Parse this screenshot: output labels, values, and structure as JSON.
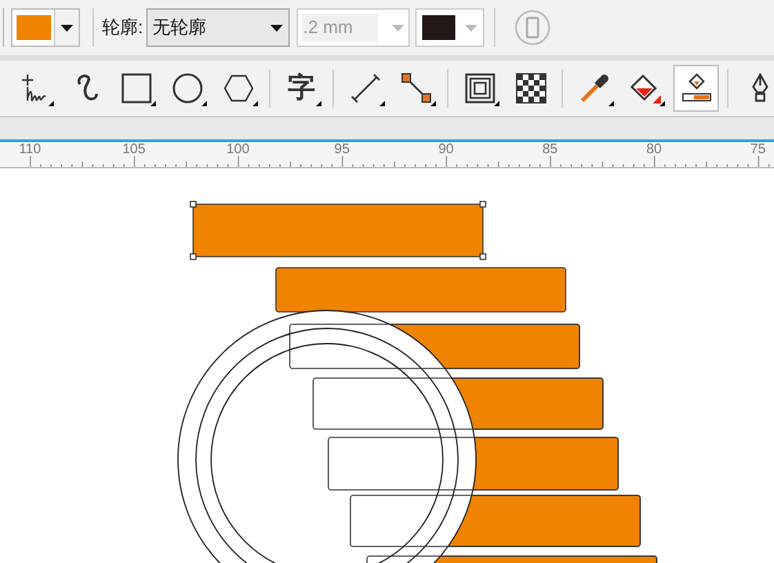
{
  "property_bar": {
    "fill": {
      "color": "#f08300"
    },
    "outline_label": "轮廓:",
    "outline_style": "无轮廓",
    "outline_width": {
      "value": ".2 mm",
      "disabled": true
    },
    "outline_swatch": {
      "color": "#231815",
      "disabled": true
    }
  },
  "toolbox": [
    {
      "kind": "freehand",
      "selected": false
    },
    {
      "kind": "spiral",
      "selected": false
    },
    {
      "kind": "rectangle",
      "selected": false
    },
    {
      "kind": "ellipse",
      "selected": false
    },
    {
      "kind": "polygon",
      "selected": false
    },
    {
      "kind": "text",
      "label": "字",
      "selected": false
    },
    {
      "kind": "dimension",
      "selected": false
    },
    {
      "kind": "connector",
      "selected": false
    },
    {
      "kind": "contour",
      "selected": false
    },
    {
      "kind": "transparency",
      "selected": false
    },
    {
      "kind": "eyedropper",
      "selected": false
    },
    {
      "kind": "fill",
      "selected": false
    },
    {
      "kind": "interactive-fill",
      "selected": true
    },
    {
      "kind": "pen",
      "selected": false
    }
  ],
  "ruler": [
    "110",
    "105",
    "100",
    "95",
    "90",
    "85",
    "80",
    "75"
  ]
}
